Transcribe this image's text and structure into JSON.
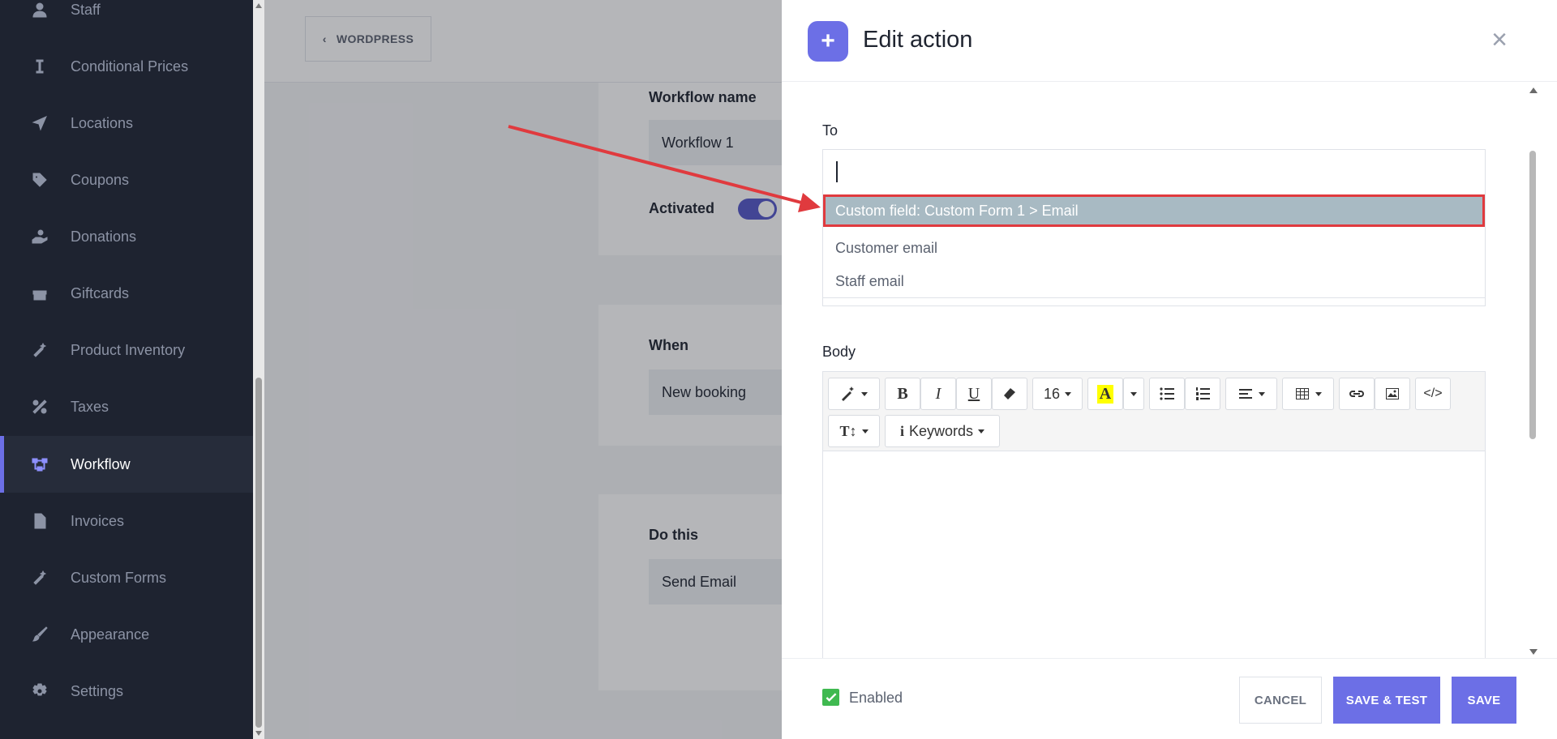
{
  "sidebar": {
    "items": [
      {
        "label": "Staff",
        "icon": "user-icon"
      },
      {
        "label": "Conditional Prices",
        "icon": "i-beam-icon"
      },
      {
        "label": "Locations",
        "icon": "location-arrow-icon"
      },
      {
        "label": "Coupons",
        "icon": "tag-icon"
      },
      {
        "label": "Donations",
        "icon": "hand-holding-icon"
      },
      {
        "label": "Giftcards",
        "icon": "gift-icon"
      },
      {
        "label": "Product Inventory",
        "icon": "magic-wand-icon"
      },
      {
        "label": "Taxes",
        "icon": "percent-icon"
      },
      {
        "label": "Workflow",
        "icon": "workflow-icon",
        "active": true
      },
      {
        "label": "Invoices",
        "icon": "file-icon"
      },
      {
        "label": "Custom Forms",
        "icon": "magic-wand-icon"
      },
      {
        "label": "Appearance",
        "icon": "brush-icon"
      },
      {
        "label": "Settings",
        "icon": "gear-icon"
      }
    ]
  },
  "main": {
    "back_label": "WORDPRESS",
    "workflow_name_label": "Workflow name",
    "workflow_name_value": "Workflow 1",
    "activated_label": "Activated",
    "when_label": "When",
    "when_value": "New booking",
    "do_this_label": "Do this",
    "do_this_value": "Send Email"
  },
  "panel": {
    "title": "Edit action",
    "to_label": "To",
    "to_options": [
      "Custom field: Custom Form 1 > Email",
      "Customer email",
      "Staff email"
    ],
    "body_label": "Body",
    "toolbar": {
      "font_size": "16",
      "keywords_label": "Keywords"
    },
    "enabled_label": "Enabled",
    "cancel_label": "CANCEL",
    "save_test_label": "SAVE & TEST",
    "save_label": "SAVE"
  },
  "colors": {
    "sidebar_bg": "#1e2330",
    "accent": "#6c6fe6",
    "highlight_border": "#e03a3e",
    "selected_option_bg": "#a8bac3",
    "enabled_check": "#3fb950"
  }
}
